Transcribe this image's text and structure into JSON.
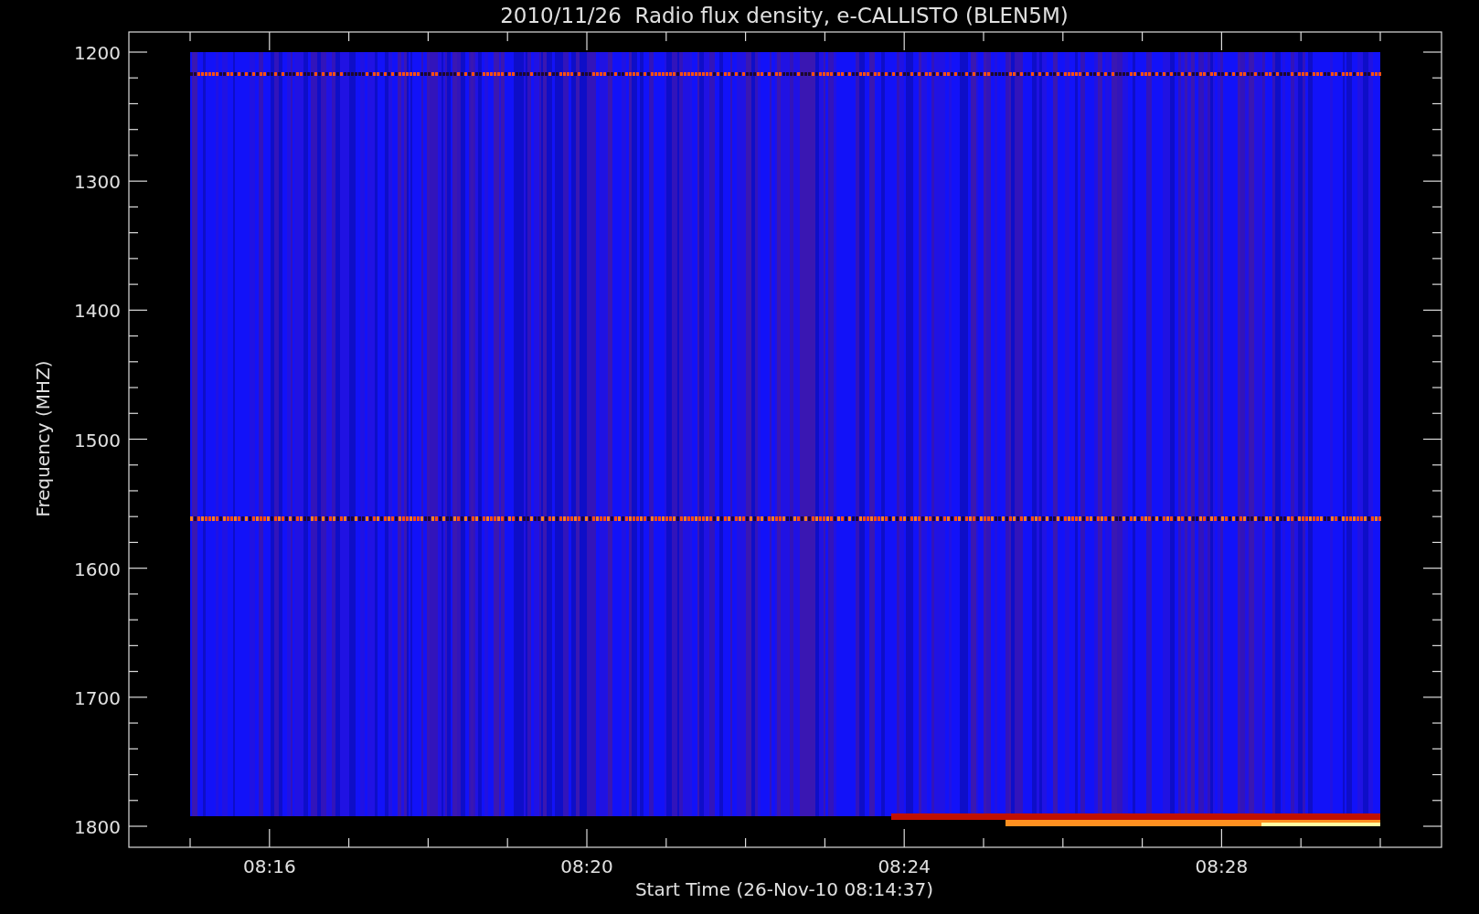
{
  "title": "2010/11/26  Radio flux density, e-CALLISTO (BLEN5M)",
  "y_axis": {
    "label": "Frequency (MHZ)",
    "ticks": [
      "1200",
      "1300",
      "1400",
      "1500",
      "1600",
      "1700",
      "1800"
    ]
  },
  "x_axis": {
    "label": "Start Time (26-Nov-10 08:14:37)",
    "ticks": [
      "08:16",
      "08:20",
      "08:24",
      "08:28"
    ]
  }
}
